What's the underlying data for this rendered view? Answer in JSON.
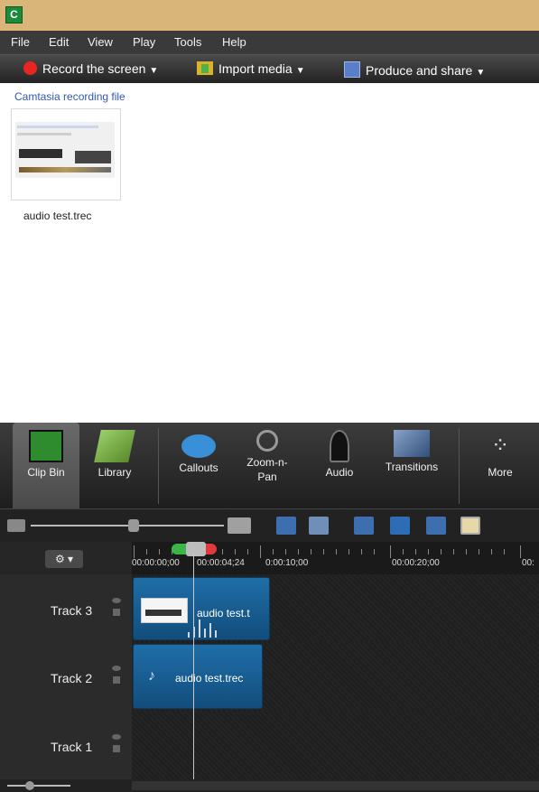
{
  "window": {
    "app_icon_letter": "C"
  },
  "menu": [
    "File",
    "Edit",
    "View",
    "Play",
    "Tools",
    "Help"
  ],
  "toolbar": {
    "record_label": "Record the screen",
    "import_label": "Import media",
    "produce_label": "Produce and share"
  },
  "clip_bin": {
    "heading": "Camtasia recording file",
    "file_name": "audio test.trec"
  },
  "tabs": [
    {
      "label": "Clip Bin",
      "icon": "clip-bin-icon",
      "active": true
    },
    {
      "label": "Library",
      "icon": "library-icon"
    },
    {
      "label": "Callouts",
      "icon": "callouts-icon"
    },
    {
      "label": "Zoom-n-Pan",
      "icon": "zoom-n-pan-icon"
    },
    {
      "label": "Audio",
      "icon": "audio-icon"
    },
    {
      "label": "Transitions",
      "icon": "transitions-icon"
    },
    {
      "label": "More",
      "icon": "more-icon"
    }
  ],
  "ruler": {
    "gear_caret": "▾",
    "time_labels": [
      "00:00:00;00",
      "00:00:04;24",
      "0:00:10;00",
      "00:00:20;00",
      "00:"
    ]
  },
  "tracks": [
    {
      "name": "Track 3",
      "clip_label": "audio test.t"
    },
    {
      "name": "Track 2",
      "clip_label": "audio test.trec"
    },
    {
      "name": "Track 1"
    }
  ],
  "colors": {
    "title_bar": "#d9b579",
    "clip_blue": "#1f6ea8",
    "record_red": "#e8261f"
  }
}
